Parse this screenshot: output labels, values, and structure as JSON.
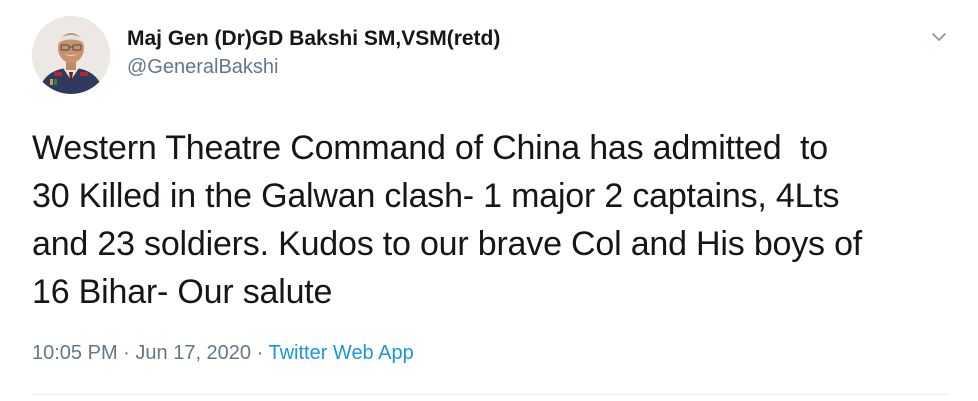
{
  "author": {
    "display_name": "Maj Gen (Dr)GD Bakshi SM,VSM(retd)",
    "handle": "@GeneralBakshi",
    "avatar_icon": "profile-photo-uniformed-officer"
  },
  "tweet": {
    "text": "Western Theatre Command of China has admitted  to\n30 Killed in the Galwan clash- 1 major 2 captains, 4Lts\nand 23 soldiers. Kudos to our brave Col and His boys of\n16 Bihar- Our salute"
  },
  "meta": {
    "time": "10:05 PM",
    "separator": " · ",
    "date": "Jun 17, 2020",
    "source": "Twitter Web App"
  },
  "menu": {
    "icon": "chevron-down-icon"
  },
  "colors": {
    "text": "#14171a",
    "secondary": "#657786",
    "link": "#1b95e0",
    "divider": "#e6ecf0"
  }
}
